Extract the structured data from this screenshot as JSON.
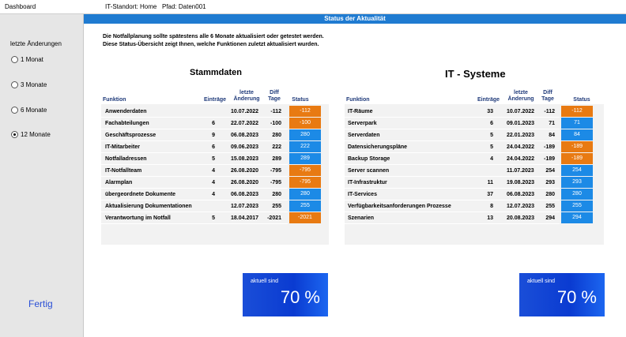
{
  "topbar": {
    "dashboard": "Dashboard",
    "standort": "IT-Standort:  Home",
    "pfad": "Pfad:  Daten001"
  },
  "sidebar": {
    "title": "letzte Änderungen",
    "options": [
      "1 Monat",
      "3 Monate",
      "6 Monate",
      "12 Monate"
    ],
    "selected": "12 Monate",
    "done": "Fertig"
  },
  "statusbar": {
    "title": "Status der Aktualität"
  },
  "intro": {
    "line1": "Die Notfallplanung sollte spätestens alle 6 Monate aktualisiert oder getestet werden.",
    "line2": "Diese Status-Übersicht zeigt Ihnen, welche Funktionen zuletzt aktualisiert wurden."
  },
  "headers": {
    "funktion": "Funktion",
    "eintraege": "Einträge",
    "aenderung": "letzte Änderung",
    "diff": "Diff Tage",
    "status": "Status"
  },
  "colors": {
    "orange": "#e87a12",
    "blue": "#1c8ae6",
    "bar": "#1f7bd1"
  },
  "stammdaten": {
    "title": "Stammdaten",
    "rows": [
      {
        "name": "Anwenderdaten",
        "count": "",
        "date": "10.07.2022",
        "diff": "-112",
        "status": "-112",
        "state": "orange"
      },
      {
        "name": "Fachabteilungen",
        "count": "6",
        "date": "22.07.2022",
        "diff": "-100",
        "status": "-100",
        "state": "orange"
      },
      {
        "name": "Geschäftsprozesse",
        "count": "9",
        "date": "06.08.2023",
        "diff": "280",
        "status": "280",
        "state": "blue"
      },
      {
        "name": "IT-Mitarbeiter",
        "count": "6",
        "date": "09.06.2023",
        "diff": "222",
        "status": "222",
        "state": "blue"
      },
      {
        "name": "Notfalladressen",
        "count": "5",
        "date": "15.08.2023",
        "diff": "289",
        "status": "289",
        "state": "blue"
      },
      {
        "name": "IT-Notfallteam",
        "count": "4",
        "date": "26.08.2020",
        "diff": "-795",
        "status": "-795",
        "state": "orange"
      },
      {
        "name": "Alarmplan",
        "count": "4",
        "date": "26.08.2020",
        "diff": "-795",
        "status": "-795",
        "state": "orange"
      },
      {
        "name": "übergeordnete Dokumente",
        "count": "4",
        "date": "06.08.2023",
        "diff": "280",
        "status": "280",
        "state": "blue"
      },
      {
        "name": "Aktualisierung Dokumentationen",
        "count": "",
        "date": "12.07.2023",
        "diff": "255",
        "status": "255",
        "state": "blue"
      },
      {
        "name": "Verantwortung im Notfall",
        "count": "5",
        "date": "18.04.2017",
        "diff": "-2021",
        "status": "-2021",
        "state": "orange"
      }
    ],
    "kpi_label": "aktuell sind",
    "kpi_value": "70 %"
  },
  "itsysteme": {
    "title": "IT - Systeme",
    "rows": [
      {
        "name": "IT-Räume",
        "count": "33",
        "date": "10.07.2022",
        "diff": "-112",
        "status": "-112",
        "state": "orange"
      },
      {
        "name": "Serverpark",
        "count": "6",
        "date": "09.01.2023",
        "diff": "71",
        "status": "71",
        "state": "blue"
      },
      {
        "name": "Serverdaten",
        "count": "5",
        "date": "22.01.2023",
        "diff": "84",
        "status": "84",
        "state": "blue"
      },
      {
        "name": "Datensicherungspläne",
        "count": "5",
        "date": "24.04.2022",
        "diff": "-189",
        "status": "-189",
        "state": "orange"
      },
      {
        "name": "Backup Storage",
        "count": "4",
        "date": "24.04.2022",
        "diff": "-189",
        "status": "-189",
        "state": "orange"
      },
      {
        "name": "Server scannen",
        "count": "",
        "date": "11.07.2023",
        "diff": "254",
        "status": "254",
        "state": "blue"
      },
      {
        "name": "IT-Infrastruktur",
        "count": "11",
        "date": "19.08.2023",
        "diff": "293",
        "status": "293",
        "state": "blue"
      },
      {
        "name": "IT-Services",
        "count": "37",
        "date": "06.08.2023",
        "diff": "280",
        "status": "280",
        "state": "blue"
      },
      {
        "name": "Verfügbarkeitsanforderungen Prozesse",
        "count": "8",
        "date": "12.07.2023",
        "diff": "255",
        "status": "255",
        "state": "blue"
      },
      {
        "name": "Szenarien",
        "count": "13",
        "date": "20.08.2023",
        "diff": "294",
        "status": "294",
        "state": "blue"
      }
    ],
    "kpi_label": "aktuell sind",
    "kpi_value": "70 %"
  }
}
